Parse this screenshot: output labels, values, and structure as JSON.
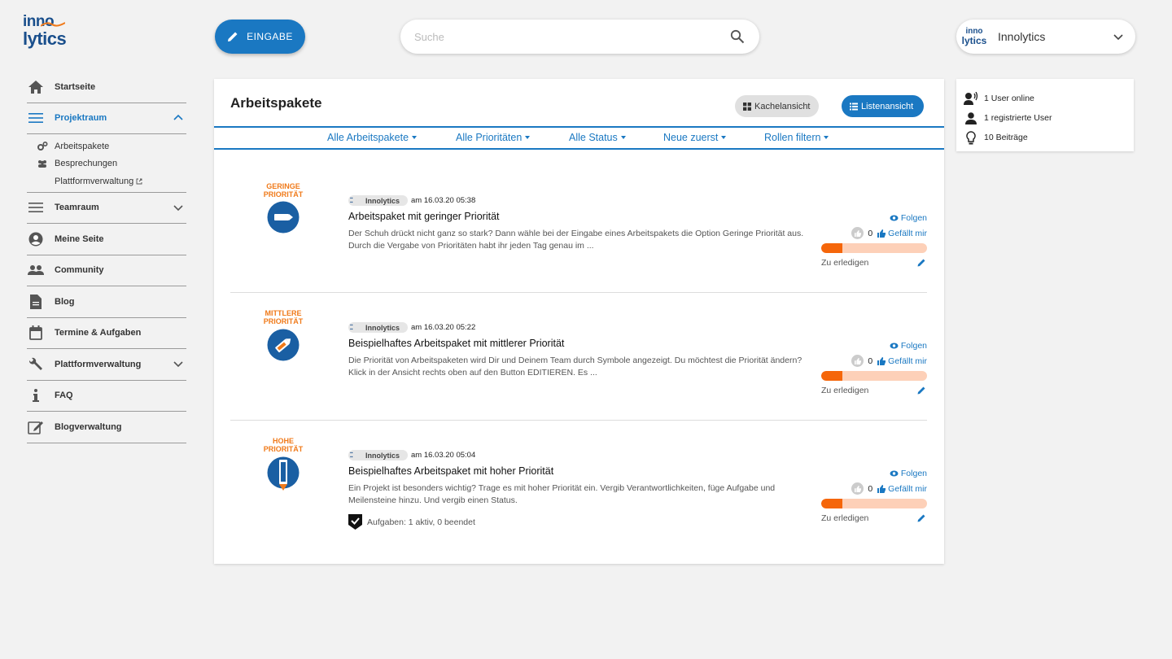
{
  "logo": {
    "line1": "inno",
    "line2": "lytics"
  },
  "sidebar": {
    "items": [
      {
        "label": "Startseite",
        "icon": "home-icon"
      },
      {
        "label": "Projektraum",
        "icon": "menu-icon",
        "active": true,
        "expanded": true,
        "children": [
          {
            "label": "Arbeitspakete",
            "icon": "cogs-icon"
          },
          {
            "label": "Besprechungen",
            "icon": "group-icon"
          },
          {
            "label": "Plattformverwaltung",
            "icon": "external-link-icon"
          }
        ]
      },
      {
        "label": "Teamraum",
        "icon": "menu-icon"
      },
      {
        "label": "Meine Seite",
        "icon": "account-circle-icon"
      },
      {
        "label": "Community",
        "icon": "people-icon"
      },
      {
        "label": "Blog",
        "icon": "document-icon"
      },
      {
        "label": "Termine & Aufgaben",
        "icon": "calendar-icon"
      },
      {
        "label": "Plattformverwaltung",
        "icon": "wrench-icon"
      },
      {
        "label": "FAQ",
        "icon": "info-icon"
      },
      {
        "label": "Blogverwaltung",
        "icon": "edit-note-icon"
      }
    ]
  },
  "topbar": {
    "eingabe_label": "EINGABE",
    "search_placeholder": "Suche",
    "account_logo_line1": "inno",
    "account_logo_line2": "lytics",
    "account_name": "Innolytics"
  },
  "main": {
    "title": "Arbeitspakete",
    "tile_view_label": "Kachelansicht",
    "list_view_label": "Listenansicht",
    "filters": [
      "Alle Arbeitspakete",
      "Alle Prioritäten",
      "Alle Status",
      "Neue zuerst",
      "Rollen filtern"
    ],
    "posts": [
      {
        "prio_line1": "GERINGE",
        "prio_line2": "PRIORITÄT",
        "author": "Innolytics",
        "date": "am 16.03.20 05:38",
        "title": "Arbeitspaket mit geringer Priorität",
        "excerpt": "Der Schuh drückt nicht ganz so stark? Dann wähle bei der Eingabe eines Arbeitspakets die Option Geringe Priorität aus. Durch die Vergabe von Prioritäten habt ihr jeden Tag genau im ...",
        "follow": "Folgen",
        "likes": "0",
        "like_label": "Gefällt mir",
        "progress": 0.2,
        "status": "Zu erledigen"
      },
      {
        "prio_line1": "MITTLERE",
        "prio_line2": "PRIORITÄT",
        "author": "Innolytics",
        "date": "am 16.03.20 05:22",
        "title": "Beispielhaftes Arbeitspaket mit mittlerer Priorität",
        "excerpt": "Die Priorität von Arbeitspaketen wird Dir und Deinem Team durch Symbole angezeigt. Du möchtest die Priorität ändern? Klick in der Ansicht rechts oben auf den Button EDITIEREN. Es ...",
        "follow": "Folgen",
        "likes": "0",
        "like_label": "Gefällt mir",
        "progress": 0.2,
        "status": "Zu erledigen"
      },
      {
        "prio_line1": "HOHE",
        "prio_line2": "PRIORITÄT",
        "author": "Innolytics",
        "date": "am 16.03.20 05:04",
        "title": "Beispielhaftes Arbeitspaket mit hoher Priorität",
        "excerpt": "Ein Projekt ist besonders wichtig? Trage es mit hoher Priorität ein. Vergib Verantwortlichkeiten, füge Aufgabe und Meilensteine hinzu. Und vergib einen Status.",
        "tasks": "Aufgaben: 1 aktiv, 0 beendet",
        "follow": "Folgen",
        "likes": "0",
        "like_label": "Gefällt mir",
        "progress": 0.2,
        "status": "Zu erledigen"
      }
    ]
  },
  "stats": {
    "online": "1 User online",
    "registered": "1 registrierte User",
    "posts": "10 Beiträge"
  },
  "colors": {
    "accent": "#1a78c2",
    "brand": "#1a4f8c",
    "priority_orange": "#f07a1a",
    "progress_fill": "#f5660a",
    "progress_track": "#fdd0b8"
  }
}
